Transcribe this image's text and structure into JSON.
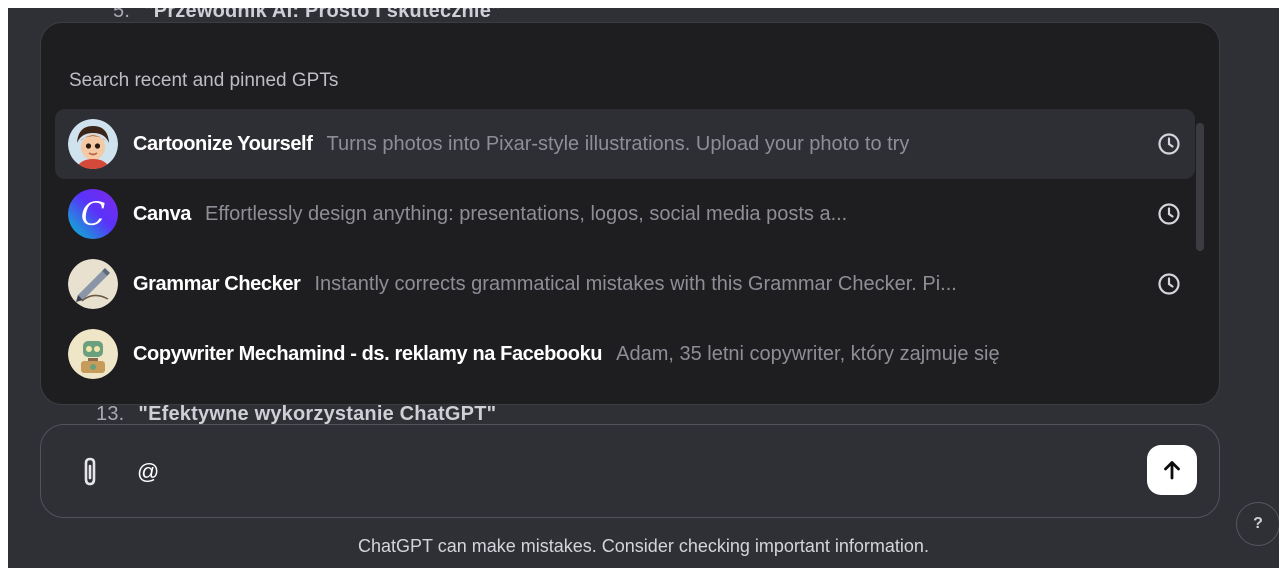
{
  "background": {
    "top_line": {
      "number": "5.",
      "text": "\"Przewodnik AI: Prosto i skutecznie\""
    },
    "bottom_line": {
      "number": "13.",
      "text": "\"Efektywne wykorzystanie ChatGPT\""
    }
  },
  "popup": {
    "header": "Search recent and pinned GPTs",
    "items": [
      {
        "name": "Cartoonize Yourself",
        "description": "Turns photos into Pixar-style illustrations. Upload your photo to try",
        "icon": "clock-icon",
        "selected": true
      },
      {
        "name": "Canva",
        "description": "Effortlessly design anything: presentations, logos, social media posts a...",
        "icon": "clock-icon"
      },
      {
        "name": "Grammar Checker",
        "description": "Instantly corrects grammatical mistakes with this Grammar Checker. Pi...",
        "icon": "clock-icon"
      },
      {
        "name": "Copywriter Mechamind - ds. reklamy na Facebooku",
        "description": "Adam, 35 letni copywriter, który zajmuje się"
      }
    ]
  },
  "composer": {
    "input_value": "@",
    "attach_icon": "paperclip-icon",
    "send_icon": "arrow-up-icon"
  },
  "footer": {
    "disclaimer": "ChatGPT can make mistakes. Consider checking important information.",
    "help_label": "?"
  },
  "colors": {
    "page_bg": "#2f2f36",
    "popup_bg": "#1e1e21",
    "selected_row": "#2e2e35",
    "accent_canva": "#7d2ae8"
  }
}
